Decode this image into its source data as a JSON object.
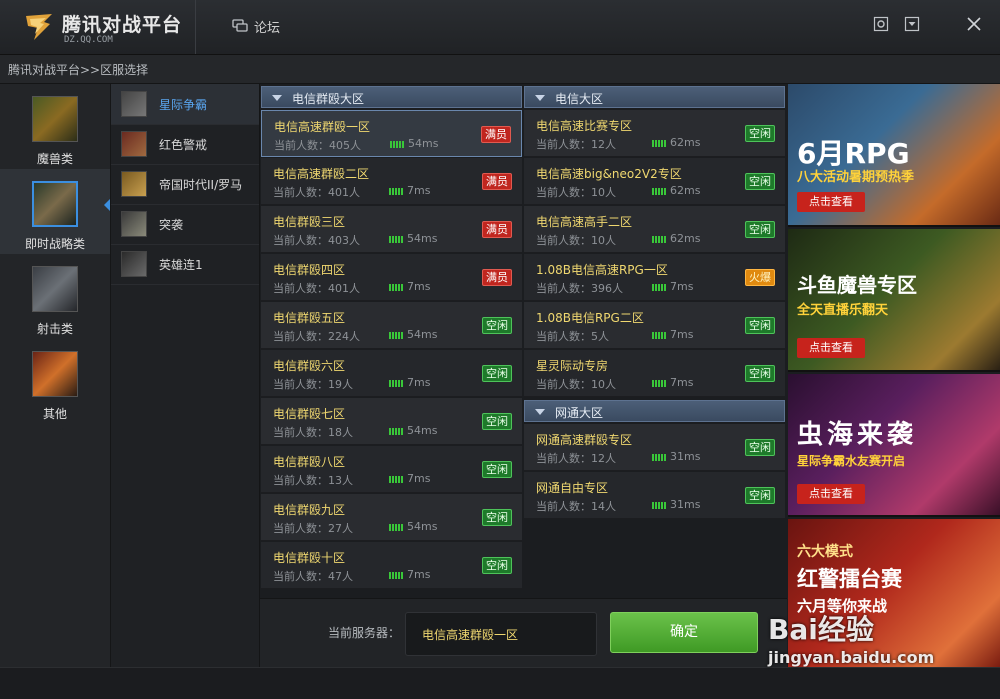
{
  "app": {
    "title": "腾讯对战平台",
    "subtitle": "DZ.QQ.COM",
    "forum_label": "论坛"
  },
  "breadcrumb": "腾讯对战平台>>区服选择",
  "categories": [
    {
      "label": "魔兽类",
      "icon": "warcraft-orc-icon",
      "active": false
    },
    {
      "label": "即时战略类",
      "icon": "rts-character-icon",
      "active": true
    },
    {
      "label": "射击类",
      "icon": "shooter-soldier-icon",
      "active": false
    },
    {
      "label": "其他",
      "icon": "racing-car-icon",
      "active": false
    }
  ],
  "games": [
    {
      "label": "星际争霸",
      "active": true
    },
    {
      "label": "红色警戒",
      "active": false
    },
    {
      "label": "帝国时代II/罗马",
      "active": false
    },
    {
      "label": "突袭",
      "active": false
    },
    {
      "label": "英雄连1",
      "active": false
    }
  ],
  "zones": {
    "left": {
      "title": "电信群殴大区",
      "servers": [
        {
          "name": "电信高速群殴一区",
          "pop": "当前人数：405人",
          "ping": "54ms",
          "status": "满员"
        },
        {
          "name": "电信高速群殴二区",
          "pop": "当前人数：401人",
          "ping": "7ms",
          "status": "满员"
        },
        {
          "name": "电信群殴三区",
          "pop": "当前人数：403人",
          "ping": "54ms",
          "status": "满员"
        },
        {
          "name": "电信群殴四区",
          "pop": "当前人数：401人",
          "ping": "7ms",
          "status": "满员"
        },
        {
          "name": "电信群殴五区",
          "pop": "当前人数：224人",
          "ping": "54ms",
          "status": "空闲"
        },
        {
          "name": "电信群殴六区",
          "pop": "当前人数：19人",
          "ping": "7ms",
          "status": "空闲"
        },
        {
          "name": "电信群殴七区",
          "pop": "当前人数：18人",
          "ping": "54ms",
          "status": "空闲"
        },
        {
          "name": "电信群殴八区",
          "pop": "当前人数：13人",
          "ping": "7ms",
          "status": "空闲"
        },
        {
          "name": "电信群殴九区",
          "pop": "当前人数：27人",
          "ping": "54ms",
          "status": "空闲"
        },
        {
          "name": "电信群殴十区",
          "pop": "当前人数：47人",
          "ping": "7ms",
          "status": "空闲"
        }
      ]
    },
    "right": {
      "title": "电信大区",
      "servers": [
        {
          "name": "电信高速比赛专区",
          "pop": "当前人数：12人",
          "ping": "62ms",
          "status": "空闲"
        },
        {
          "name": "电信高速big&neo2V2专区",
          "pop": "当前人数：10人",
          "ping": "62ms",
          "status": "空闲"
        },
        {
          "name": "电信高速高手二区",
          "pop": "当前人数：10人",
          "ping": "62ms",
          "status": "空闲"
        },
        {
          "name": "1.08B电信高速RPG一区",
          "pop": "当前人数：396人",
          "ping": "7ms",
          "status": "火爆"
        },
        {
          "name": "1.08B电信RPG二区",
          "pop": "当前人数：5人",
          "ping": "7ms",
          "status": "空闲"
        },
        {
          "name": "星灵际动专房",
          "pop": "当前人数：10人",
          "ping": "7ms",
          "status": "空闲"
        }
      ]
    },
    "right2": {
      "title": "网通大区",
      "servers": [
        {
          "name": "网通高速群殴专区",
          "pop": "当前人数：12人",
          "ping": "31ms",
          "status": "空闲"
        },
        {
          "name": "网通自由专区",
          "pop": "当前人数：14人",
          "ping": "31ms",
          "status": "空闲"
        }
      ]
    }
  },
  "selection": {
    "label": "当前服务器：",
    "value": "电信高速群殴一区",
    "confirm": "确定"
  },
  "ads": [
    {
      "title": "6月RPG",
      "subtitle": "八大活动暑期预热季",
      "button": "点击查看",
      "colors": [
        "#c46b2a",
        "#3a6b94"
      ]
    },
    {
      "title": "斗鱼魔兽专区",
      "subtitle": "全天直播乐翻天",
      "button": "点击查看",
      "colors": [
        "#3d5a22",
        "#9c7a30"
      ]
    },
    {
      "title": "虫海来袭",
      "subtitle": "星际争霸水友赛开启",
      "button": "点击查看",
      "colors": [
        "#5a1f5e",
        "#b03a6a"
      ]
    },
    {
      "title": "六大模式",
      "subtitle": "红警擂台赛",
      "extra": "六月等你来战",
      "colors": [
        "#b0281c",
        "#e0703a"
      ]
    }
  ],
  "watermark": {
    "brand": "Bai经验",
    "url": "jingyan.baidu.com"
  }
}
